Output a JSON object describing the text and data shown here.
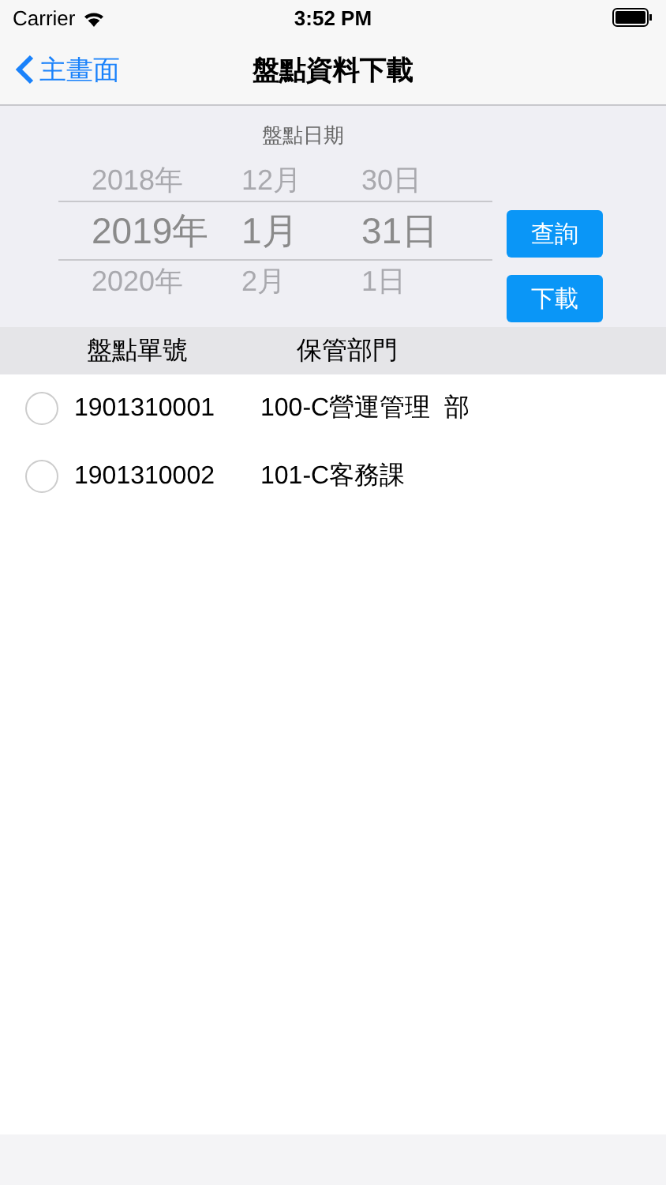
{
  "status_bar": {
    "carrier": "Carrier",
    "time": "3:52 PM"
  },
  "nav": {
    "back": "主畫面",
    "title": "盤點資料下載"
  },
  "date_picker": {
    "label": "盤點日期",
    "rows": [
      {
        "year": "2018年",
        "month": "12月",
        "day": "30日",
        "selected": false
      },
      {
        "year": "2019年",
        "month": "1月",
        "day": "31日",
        "selected": true
      },
      {
        "year": "2020年",
        "month": "2月",
        "day": "1日",
        "selected": false
      }
    ]
  },
  "buttons": [
    "查詢",
    "下載"
  ],
  "table": {
    "columns": [
      "盤點單號",
      "保管部門"
    ],
    "rows": [
      {
        "number": "1901310001",
        "department": "100-C營運管理  部",
        "checked": false
      },
      {
        "number": "1901310002",
        "department": "101-C客務課",
        "checked": false
      }
    ]
  }
}
